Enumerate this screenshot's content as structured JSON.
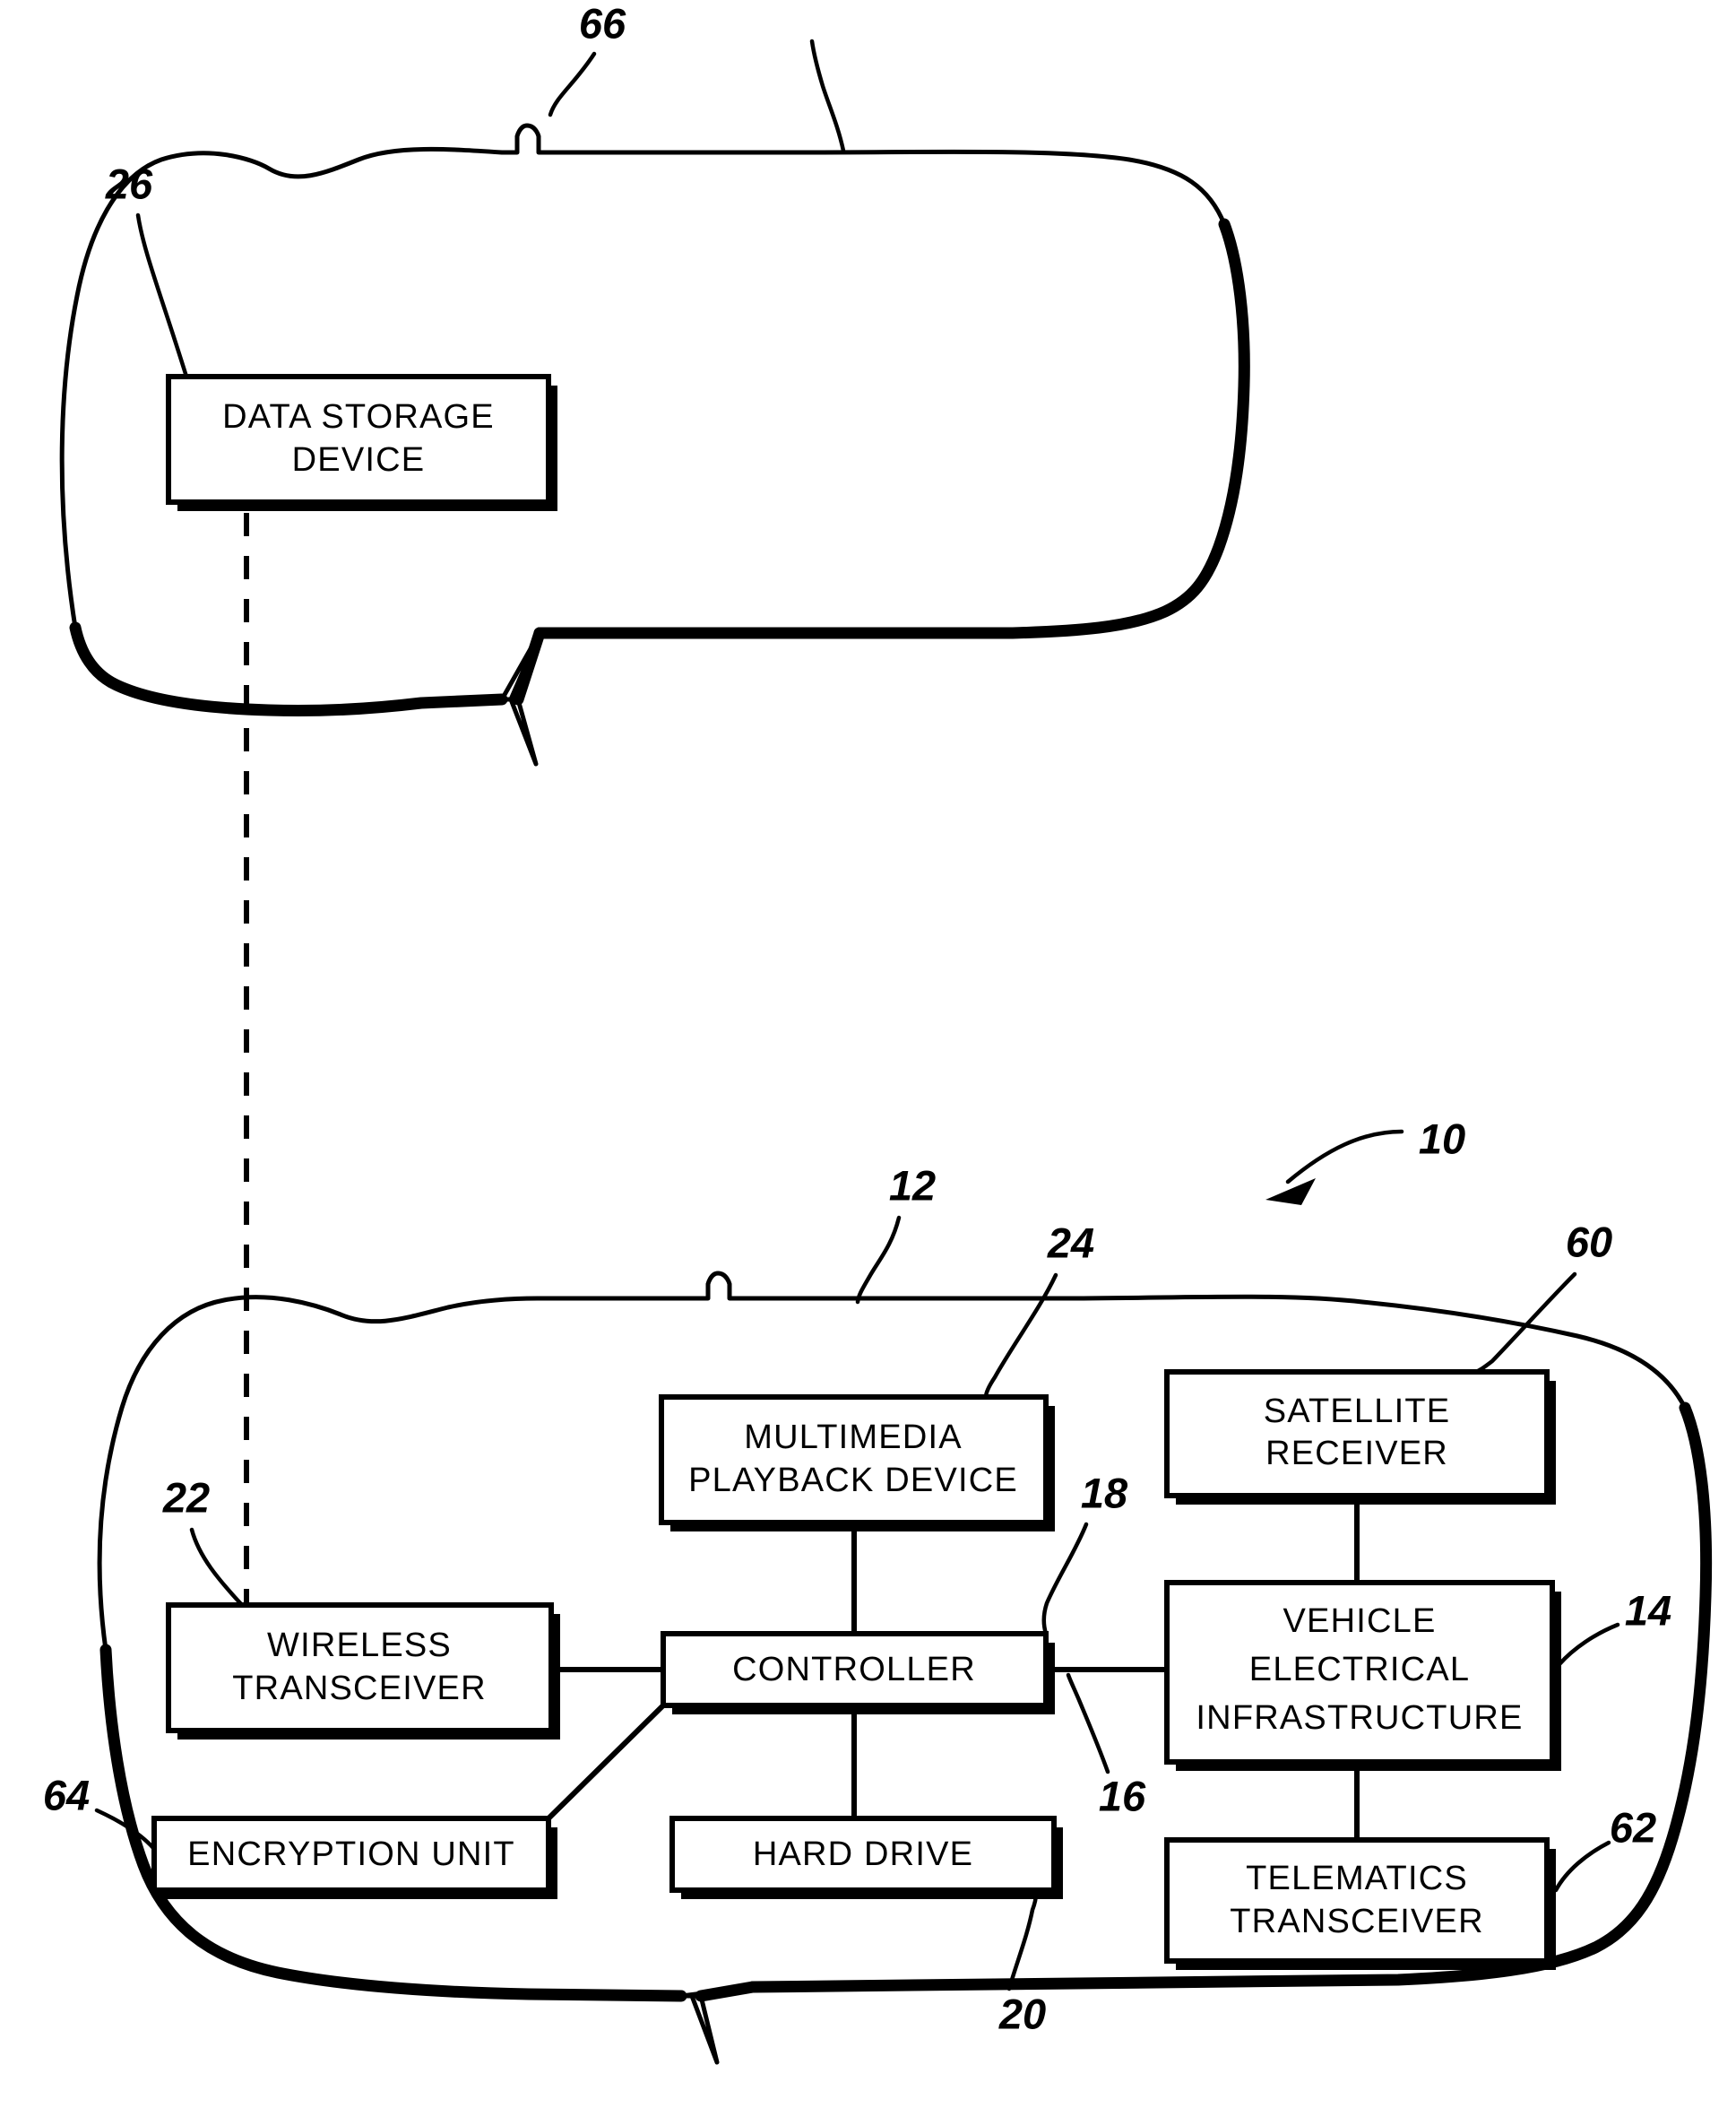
{
  "figure": {
    "type": "patent-block-diagram",
    "title": "",
    "background_color": "#ffffff",
    "line_color": "#000000"
  },
  "enclosures": [
    {
      "id": "remote-vehicle",
      "ref": "66",
      "name": "remote vehicle outline",
      "label": "66"
    },
    {
      "id": "host-vehicle",
      "ref": "12",
      "name": "host vehicle outline",
      "label": "12"
    }
  ],
  "system": {
    "ref": "10",
    "label": "10",
    "name": "system reference arrow"
  },
  "blocks": [
    {
      "id": "data-storage-device",
      "lines": [
        "DATA STORAGE",
        "DEVICE"
      ],
      "ref": "26",
      "ref_label": "26"
    },
    {
      "id": "multimedia-playback-device",
      "lines": [
        "MULTIMEDIA",
        "PLAYBACK DEVICE"
      ],
      "ref": "24",
      "ref_label": "24"
    },
    {
      "id": "satellite-receiver",
      "lines": [
        "SATELLITE",
        "RECEIVER"
      ],
      "ref": "60",
      "ref_label": "60"
    },
    {
      "id": "wireless-transceiver",
      "lines": [
        "WIRELESS",
        "TRANSCEIVER"
      ],
      "ref": "22",
      "ref_label": "22"
    },
    {
      "id": "controller",
      "lines": [
        "CONTROLLER"
      ],
      "ref": "18",
      "ref_label": "18"
    },
    {
      "id": "vehicle-electrical-infrastructure",
      "lines": [
        "VEHICLE",
        "ELECTRICAL",
        "INFRASTRUCTURE"
      ],
      "ref": "14",
      "ref_label": "14"
    },
    {
      "id": "encryption-unit",
      "lines": [
        "ENCRYPTION UNIT"
      ],
      "ref": "64",
      "ref_label": "64"
    },
    {
      "id": "hard-drive",
      "lines": [
        "HARD DRIVE"
      ],
      "ref": "20",
      "ref_label": "20"
    },
    {
      "id": "telematics-transceiver",
      "lines": [
        "TELEMATICS",
        "TRANSCEIVER"
      ],
      "ref": "62",
      "ref_label": "62"
    }
  ],
  "reference_numerals": {
    "n10": "10",
    "n12": "12",
    "n14": "14",
    "n16": "16",
    "n18": "18",
    "n20": "20",
    "n22": "22",
    "n24": "24",
    "n26": "26",
    "n60": "60",
    "n62": "62",
    "n64": "64",
    "n66": "66"
  },
  "block_text": {
    "data_storage_line1": "DATA STORAGE",
    "data_storage_line2": "DEVICE",
    "multimedia_line1": "MULTIMEDIA",
    "multimedia_line2": "PLAYBACK DEVICE",
    "satellite_line1": "SATELLITE",
    "satellite_line2": "RECEIVER",
    "wireless_line1": "WIRELESS",
    "wireless_line2": "TRANSCEIVER",
    "controller_line1": "CONTROLLER",
    "vei_line1": "VEHICLE",
    "vei_line2": "ELECTRICAL",
    "vei_line3": "INFRASTRUCTURE",
    "encryption_line1": "ENCRYPTION UNIT",
    "harddrive_line1": "HARD DRIVE",
    "telematics_line1": "TELEMATICS",
    "telematics_line2": "TRANSCEIVER"
  },
  "connections": [
    {
      "from": "data-storage-device",
      "to": "wireless-transceiver",
      "style": "dashed",
      "ref": ""
    },
    {
      "from": "multimedia-playback-device",
      "to": "controller",
      "style": "solid",
      "ref": ""
    },
    {
      "from": "wireless-transceiver",
      "to": "controller",
      "style": "solid",
      "ref": ""
    },
    {
      "from": "encryption-unit",
      "to": "controller",
      "style": "solid",
      "ref": ""
    },
    {
      "from": "controller",
      "to": "hard-drive",
      "style": "solid",
      "ref": ""
    },
    {
      "from": "controller",
      "to": "vehicle-electrical-infrastructure",
      "style": "solid",
      "ref": "16"
    },
    {
      "from": "satellite-receiver",
      "to": "vehicle-electrical-infrastructure",
      "style": "solid",
      "ref": ""
    },
    {
      "from": "vehicle-electrical-infrastructure",
      "to": "telematics-transceiver",
      "style": "solid",
      "ref": ""
    }
  ]
}
